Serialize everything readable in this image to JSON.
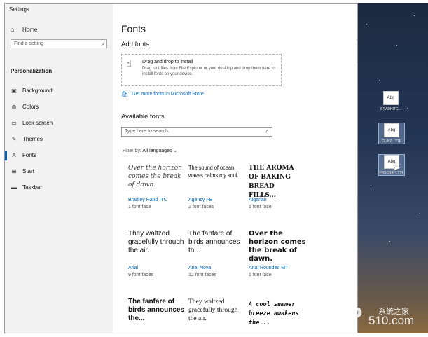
{
  "window": {
    "title": "Settings",
    "controls": {
      "minimize": "—",
      "maximize": "□",
      "close": "✕"
    }
  },
  "sidebar": {
    "home": "Home",
    "search_placeholder": "Find a setting",
    "section": "Personalization",
    "items": [
      {
        "label": "Background",
        "icon": "picture-icon"
      },
      {
        "label": "Colors",
        "icon": "palette-icon"
      },
      {
        "label": "Lock screen",
        "icon": "lock-screen-icon"
      },
      {
        "label": "Themes",
        "icon": "brush-icon"
      },
      {
        "label": "Fonts",
        "icon": "font-icon"
      },
      {
        "label": "Start",
        "icon": "start-icon"
      },
      {
        "label": "Taskbar",
        "icon": "taskbar-icon"
      }
    ],
    "active": "Fonts"
  },
  "main": {
    "title": "Fonts",
    "add_fonts": "Add fonts",
    "drop_title": "Drag and drop to install",
    "drop_desc": "Drag font files from File Explorer or your desktop and drop them here to install fonts on your device.",
    "store_link": "Get more fonts in Microsoft Store",
    "available_fonts": "Available fonts",
    "search_placeholder": "Type here to search.",
    "filter_label": "Filter by:",
    "filter_value": "All languages",
    "fonts": [
      {
        "sample": "Over the horizon comes the break of dawn.",
        "name": "Bradley Hand ITC",
        "faces": "1 font face"
      },
      {
        "sample": "The sound of ocean waves calms my soul.",
        "name": "Agency FB",
        "faces": "2 font faces"
      },
      {
        "sample": "THE AROMA OF BAKING BREAD FILLS...",
        "name": "Algerian",
        "faces": "1 font face"
      },
      {
        "sample": "They waltzed gracefully through the air.",
        "name": "Arial",
        "faces": "9 font faces"
      },
      {
        "sample": "The fanfare of birds announces th...",
        "name": "Arial Nova",
        "faces": "12 font faces"
      },
      {
        "sample": "Over the horizon comes the break of dawn.",
        "name": "Arial Rounded MT",
        "faces": "1 font face"
      },
      {
        "sample": "The fanfare of birds announces the...",
        "name": "",
        "faces": ""
      },
      {
        "sample": "They waltzed gracefully through the air.",
        "name": "",
        "faces": ""
      },
      {
        "sample": "A cool summer breeze awakens the...",
        "name": "",
        "faces": ""
      }
    ]
  },
  "desktop": {
    "icons": [
      {
        "thumb": "Abg",
        "label": "BRADHITC..."
      },
      {
        "thumb": "Abg",
        "label": "GUNZ...TTF"
      },
      {
        "thumb": "Abg",
        "label": "FRSCRIPT.TTF"
      }
    ]
  },
  "watermark": {
    "mark": "XP",
    "cn": "系统之家",
    "num": "510.com"
  }
}
